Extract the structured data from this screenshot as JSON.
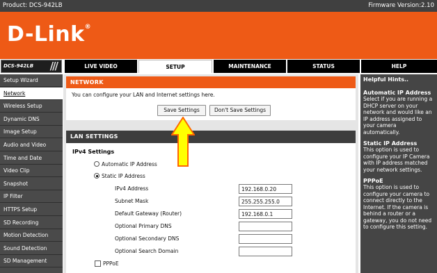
{
  "topbar": {
    "product": "Product: DCS-942LB",
    "firmware": "Firmware Version:2.10"
  },
  "brand": {
    "logo": "D-Link",
    "reg": "®",
    "color": "#ee5a16"
  },
  "nav": {
    "model": "DCS-942LB",
    "tabs": [
      {
        "label": "LIVE VIDEO"
      },
      {
        "label": "SETUP",
        "active": true
      },
      {
        "label": "MAINTENANCE"
      },
      {
        "label": "STATUS"
      },
      {
        "label": "HELP"
      }
    ]
  },
  "sidebar": {
    "items": [
      {
        "label": "Setup Wizard"
      },
      {
        "label": "Network",
        "active": true
      },
      {
        "label": "Wireless Setup"
      },
      {
        "label": "Dynamic DNS"
      },
      {
        "label": "Image Setup"
      },
      {
        "label": "Audio and Video"
      },
      {
        "label": "Time and Date"
      },
      {
        "label": "Video Clip"
      },
      {
        "label": "Snapshot"
      },
      {
        "label": "IP Filter"
      },
      {
        "label": "HTTPS Setup"
      },
      {
        "label": "SD Recording"
      },
      {
        "label": "Motion Detection"
      },
      {
        "label": "Sound Detection"
      },
      {
        "label": "SD Management"
      }
    ]
  },
  "network": {
    "title": "NETWORK",
    "description": "You can configure your LAN and Internet settings here.",
    "save_label": "Save Settings",
    "dont_save_label": "Don't Save Settings"
  },
  "lan": {
    "title": "LAN SETTINGS",
    "ipv4_title": "IPv4 Settings",
    "auto_label": "Automatic IP Address",
    "static_label": "Static IP Address",
    "selected": "static",
    "fields": [
      {
        "label": "IPv4 Address",
        "value": "192.168.0.20"
      },
      {
        "label": "Subnet Mask",
        "value": "255.255.255.0"
      },
      {
        "label": "Default Gateway (Router)",
        "value": "192.168.0.1"
      },
      {
        "label": "Optional Primary DNS",
        "value": ""
      },
      {
        "label": "Optional Secondary DNS",
        "value": ""
      },
      {
        "label": "Optional Search Domain",
        "value": ""
      }
    ],
    "pppoe_label": "PPPoE",
    "pppoe_checked": false
  },
  "hints": {
    "title": "Helpful Hints..",
    "sections": [
      {
        "heading": "Automatic IP Address",
        "text": "Select if you are running a DHCP server on your network and would like an IP address assigned to your camera automatically."
      },
      {
        "heading": "Static IP Address",
        "text": "This option is used to configure your IP Camera with IP address matched your network settings."
      },
      {
        "heading": "PPPoE",
        "text": "This option is used to configure your camera to connect directly to the Internet. If the camera is behind a router or a gateway, you do not need to configure this setting."
      }
    ]
  },
  "annotation": {
    "arrow_fill": "#ffff00",
    "arrow_stroke": "#ff6600"
  }
}
